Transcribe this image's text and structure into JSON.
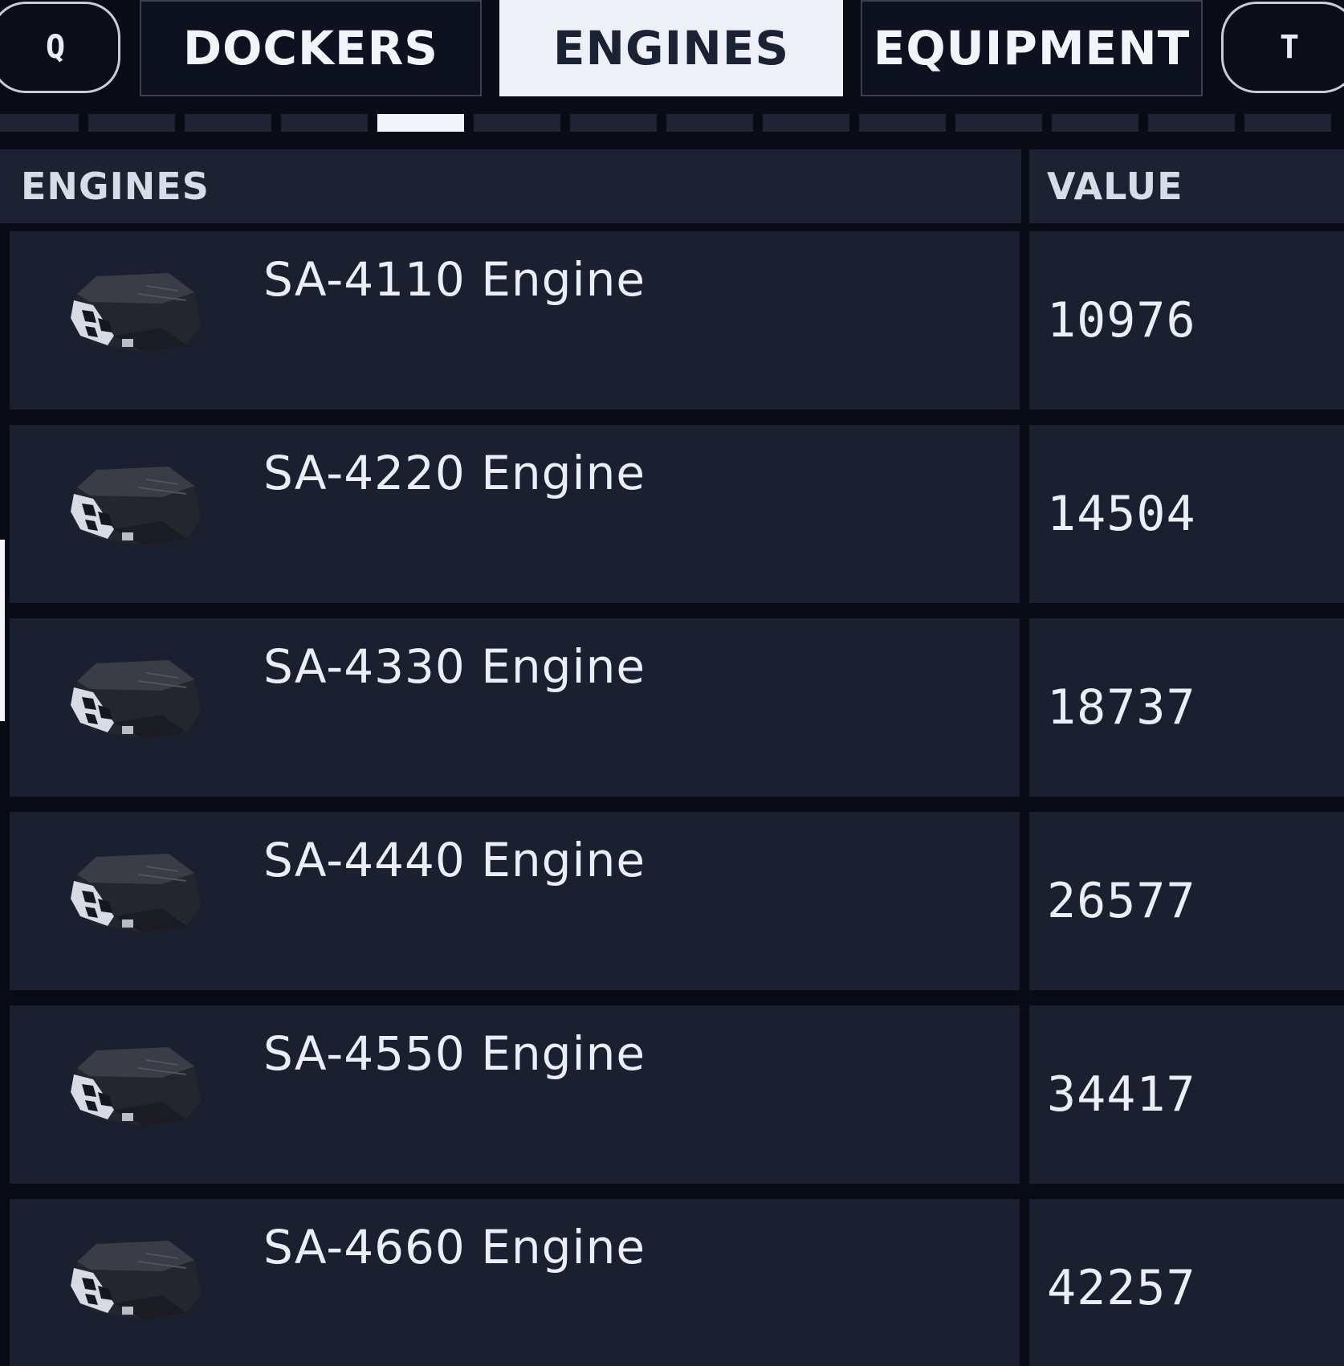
{
  "tabbar": {
    "left_key": "Q",
    "right_key": "T",
    "tabs": [
      {
        "label": "DOCKERS",
        "active": false
      },
      {
        "label": "ENGINES",
        "active": true
      },
      {
        "label": "EQUIPMENT",
        "active": false
      }
    ],
    "page_count": 14,
    "active_page_index": 4
  },
  "table": {
    "headers": {
      "name": "ENGINES",
      "value": "VALUE"
    },
    "rows": [
      {
        "name": "SA-4110 Engine",
        "value": "10976",
        "icon": "engine-icon"
      },
      {
        "name": "SA-4220 Engine",
        "value": "14504",
        "icon": "engine-icon"
      },
      {
        "name": "SA-4330 Engine",
        "value": "18737",
        "icon": "engine-icon"
      },
      {
        "name": "SA-4440 Engine",
        "value": "26577",
        "icon": "engine-icon"
      },
      {
        "name": "SA-4550 Engine",
        "value": "34417",
        "icon": "engine-icon"
      },
      {
        "name": "SA-4660 Engine",
        "value": "42257",
        "icon": "engine-icon"
      }
    ]
  },
  "colors": {
    "background": "#090c16",
    "cell": "#1b2030",
    "active_tab": "#eef0f7",
    "text": "#eceef5"
  }
}
